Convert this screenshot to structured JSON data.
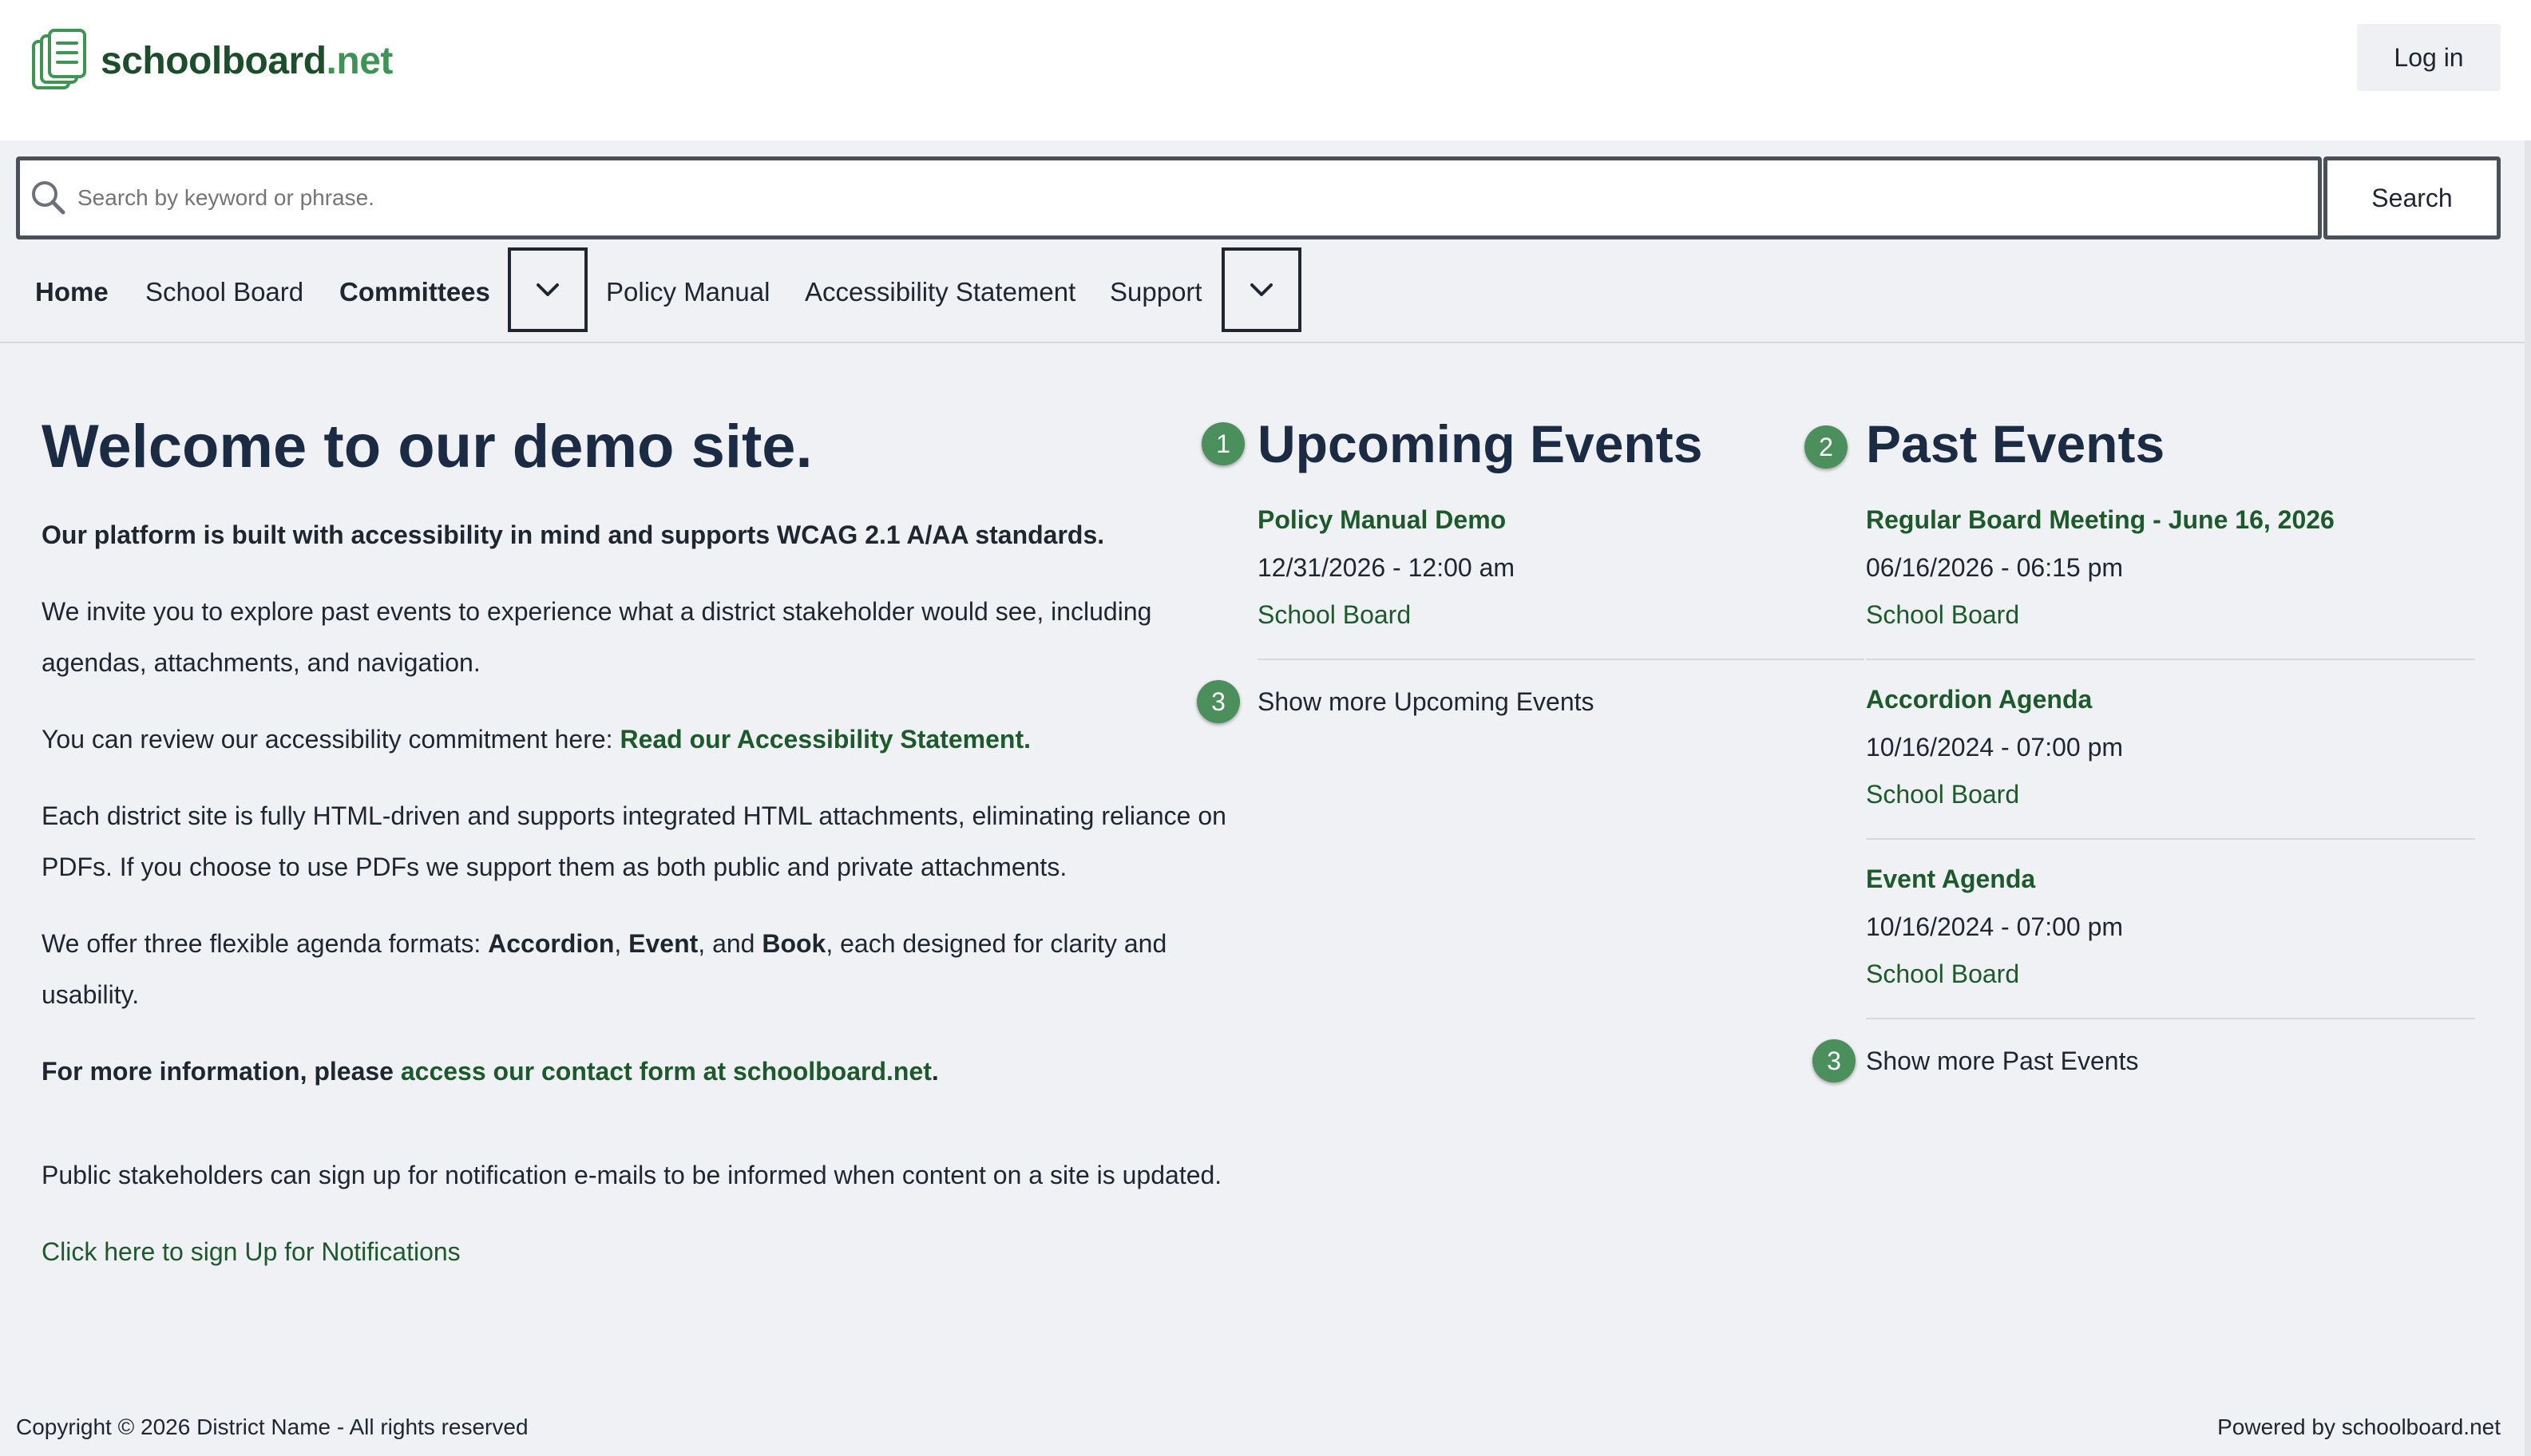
{
  "header": {
    "logo_name": "schoolboard",
    "logo_tld": ".net",
    "login_label": "Log in"
  },
  "search": {
    "placeholder": "Search by keyword or phrase.",
    "button_label": "Search"
  },
  "nav": {
    "home": "Home",
    "school_board": "School Board",
    "committees": "Committees",
    "policy_manual": "Policy Manual",
    "accessibility_statement": "Accessibility Statement",
    "support": "Support"
  },
  "welcome": {
    "title": "Welcome to our demo site.",
    "p1": "Our platform is built with accessibility in mind and supports WCAG 2.1 A/AA standards.",
    "p2": "We invite you to explore past events to experience what a district stakeholder would see, including agendas, attachments, and navigation.",
    "p3_prefix": "You can review our accessibility commitment here: ",
    "p3_link": "Read our Accessibility Statement.",
    "p4": "Each district site is fully HTML-driven and supports integrated HTML attachments, eliminating reliance on PDFs. If you choose to use PDFs we support them as both public and private attachments.",
    "p5_prefix": "We offer three flexible agenda formats: ",
    "p5_a": "Accordion",
    "p5_sep1": ", ",
    "p5_b": "Event",
    "p5_sep2": ", and ",
    "p5_c": "Book",
    "p5_suffix": ", each designed for clarity and usability.",
    "p6_prefix": "For more information, please ",
    "p6_link": "access our contact form at schoolboard.net",
    "p6_suffix": ".",
    "p7": "Public stakeholders can sign up for notification e-mails to be informed when content on a site is updated.",
    "signup_link": "Click here to sign Up for Notifications"
  },
  "upcoming": {
    "badge": "1",
    "title": "Upcoming Events",
    "events": [
      {
        "title": "Policy Manual Demo",
        "date": "12/31/2026 - 12:00 am",
        "category": "School Board"
      }
    ],
    "more_badge": "3",
    "more_label": "Show more Upcoming Events"
  },
  "past": {
    "badge": "2",
    "title": "Past Events",
    "events": [
      {
        "title": "Regular Board Meeting - June 16, 2026",
        "date": "06/16/2026 - 06:15 pm",
        "category": "School Board"
      },
      {
        "title": "Accordion Agenda",
        "date": "10/16/2024 - 07:00 pm",
        "category": "School Board"
      },
      {
        "title": "Event Agenda",
        "date": "10/16/2024 - 07:00 pm",
        "category": "School Board"
      }
    ],
    "more_badge": "3",
    "more_label": "Show more Past Events"
  },
  "footer": {
    "copyright": "Copyright © 2026 District Name - All rights reserved",
    "powered_by": "Powered by schoolboard.net"
  },
  "colors": {
    "brand_dark": "#1d4e2b",
    "brand_accent": "#3e9452",
    "link": "#1d5a2b",
    "heading": "#1c2b44",
    "badge": "#4b8f5c",
    "background": "#f0f1f5"
  },
  "icons": [
    "logo-documents-icon",
    "search-icon",
    "chevron-down-icon"
  ]
}
